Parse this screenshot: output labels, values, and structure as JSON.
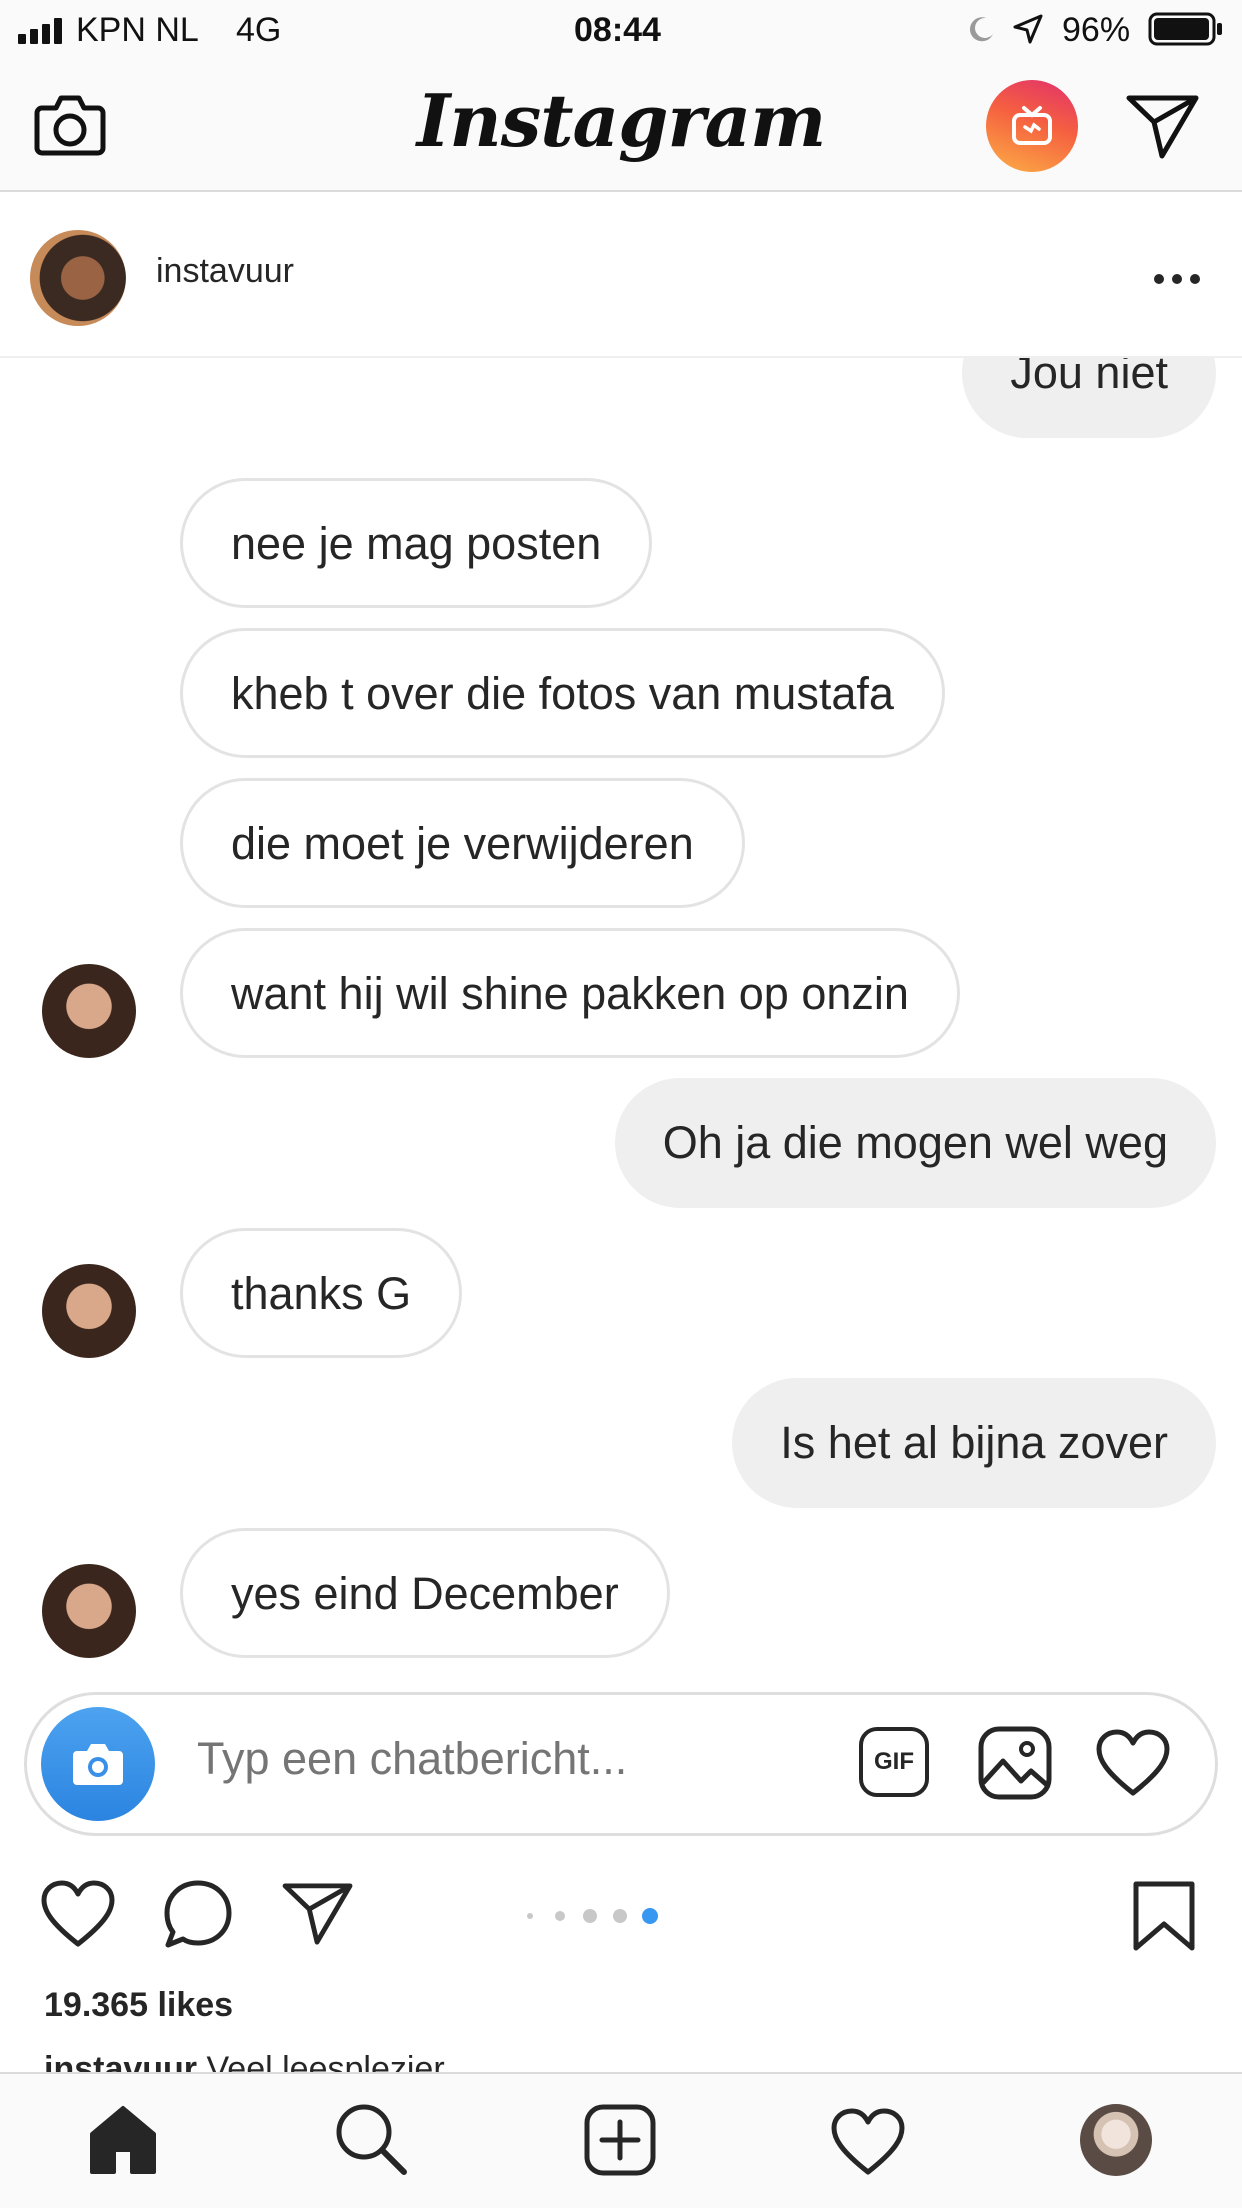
{
  "status_bar": {
    "carrier": "KPN NL",
    "network": "4G",
    "time": "08:44",
    "battery": "96%"
  },
  "top_nav": {
    "logo_text": "Instagram",
    "icons": [
      "camera-icon",
      "igtv-icon",
      "direct-send-icon"
    ]
  },
  "post": {
    "username": "instavuur",
    "more_icon": "more-dots-icon"
  },
  "chat": {
    "messages": [
      {
        "side": "out",
        "text": "Jou niet"
      },
      {
        "side": "in",
        "text": "nee je mag posten"
      },
      {
        "side": "in",
        "text": "kheb t over die fotos van mustafa"
      },
      {
        "side": "in",
        "text": "die moet je verwijderen"
      },
      {
        "side": "in",
        "text": "want hij wil shine pakken op onzin"
      },
      {
        "side": "out",
        "text": "Oh ja die mogen wel weg"
      },
      {
        "side": "in",
        "text": "thanks G"
      },
      {
        "side": "out",
        "text": "Is het al bijna zover"
      },
      {
        "side": "in",
        "text": "yes eind December"
      }
    ]
  },
  "composer": {
    "placeholder": "Typ een chatbericht...",
    "gif_label": "GIF"
  },
  "actions": {
    "likes": "19.365 likes",
    "caption_user": "instavuur",
    "caption_text": "Veel leesplezier",
    "carousel_count": 5,
    "carousel_active_index": 4,
    "accent_color": "#3897f0"
  },
  "tab_bar": {
    "items": [
      "home-icon",
      "search-icon",
      "add-post-icon",
      "activity-heart-icon",
      "profile-avatar"
    ]
  }
}
